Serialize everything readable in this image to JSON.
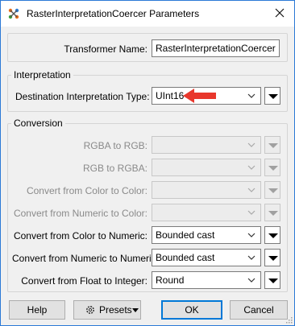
{
  "window": {
    "title": "RasterInterpretationCoercer Parameters"
  },
  "transformer_name": {
    "label": "Transformer Name:",
    "value": "RasterInterpretationCoercer"
  },
  "interpretation": {
    "group_title": "Interpretation",
    "destination_label": "Destination Interpretation Type:",
    "destination_value": "UInt16"
  },
  "conversion": {
    "group_title": "Conversion",
    "rows": [
      {
        "label": "RGBA to RGB:",
        "value": "",
        "enabled": false
      },
      {
        "label": "RGB to RGBA:",
        "value": "",
        "enabled": false
      },
      {
        "label": "Convert from Color to Color:",
        "value": "",
        "enabled": false
      },
      {
        "label": "Convert from Numeric to Color:",
        "value": "",
        "enabled": false
      },
      {
        "label": "Convert from Color to Numeric:",
        "value": "Bounded cast",
        "enabled": true
      },
      {
        "label": "Convert from Numeric to Numeric:",
        "value": "Bounded cast",
        "enabled": true
      },
      {
        "label": "Convert from Float to Integer:",
        "value": "Round",
        "enabled": true
      }
    ]
  },
  "buttons": {
    "help": "Help",
    "presets": "Presets",
    "ok": "OK",
    "cancel": "Cancel"
  },
  "colors": {
    "accent_blue": "#0078d7",
    "arrow_red": "#e8372c",
    "window_border": "#2b79d6"
  }
}
